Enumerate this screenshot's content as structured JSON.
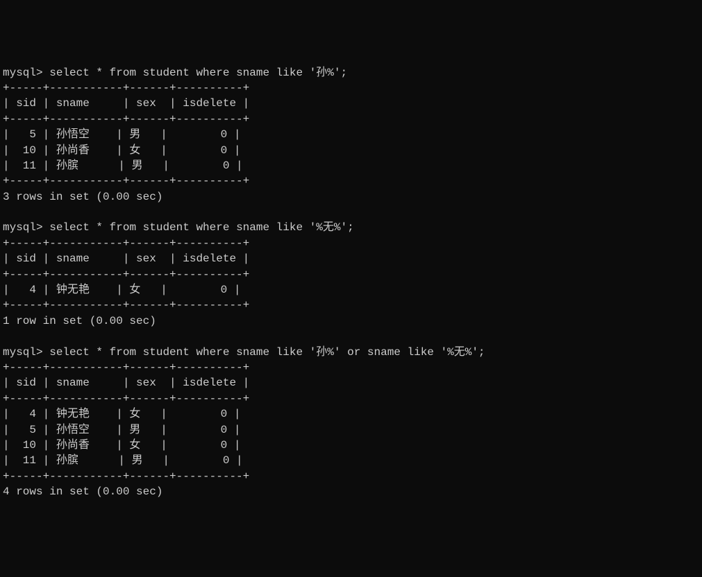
{
  "queries": [
    {
      "prompt": "mysql> ",
      "command": "select * from student where sname like '孙%';",
      "border_top": "+-----+-----------+------+----------+",
      "header": "| sid | sname     | sex  | isdelete |",
      "border_mid": "+-----+-----------+------+----------+",
      "rows": [
        "|   5 | 孙悟空    | 男   |        0 |",
        "|  10 | 孙尚香    | 女   |        0 |",
        "|  11 | 孙膑      | 男   |        0 |"
      ],
      "border_bottom": "+-----+-----------+------+----------+",
      "result": "3 rows in set (0.00 sec)"
    },
    {
      "prompt": "mysql> ",
      "command": "select * from student where sname like '%无%';",
      "border_top": "+-----+-----------+------+----------+",
      "header": "| sid | sname     | sex  | isdelete |",
      "border_mid": "+-----+-----------+------+----------+",
      "rows": [
        "|   4 | 钟无艳    | 女   |        0 |"
      ],
      "border_bottom": "+-----+-----------+------+----------+",
      "result": "1 row in set (0.00 sec)"
    },
    {
      "prompt": "mysql> ",
      "command": "select * from student where sname like '孙%' or sname like '%无%';",
      "border_top": "+-----+-----------+------+----------+",
      "header": "| sid | sname     | sex  | isdelete |",
      "border_mid": "+-----+-----------+------+----------+",
      "rows": [
        "|   4 | 钟无艳    | 女   |        0 |",
        "|   5 | 孙悟空    | 男   |        0 |",
        "|  10 | 孙尚香    | 女   |        0 |",
        "|  11 | 孙膑      | 男   |        0 |"
      ],
      "border_bottom": "+-----+-----------+------+----------+",
      "result": "4 rows in set (0.00 sec)"
    }
  ]
}
